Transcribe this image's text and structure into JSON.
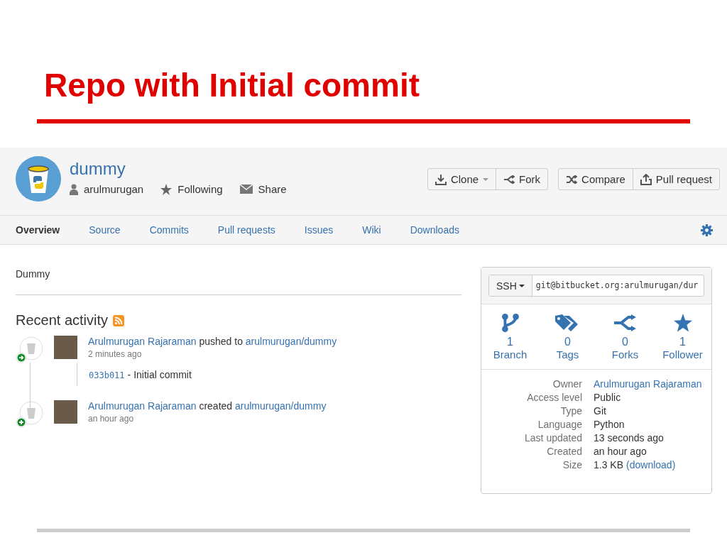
{
  "slide": {
    "title": "Repo with Initial commit"
  },
  "repo": {
    "name": "dummy",
    "owner": "arulmurugan",
    "follow": "Following",
    "share": "Share"
  },
  "action_groups": [
    [
      {
        "label": "Clone",
        "kind": "clone"
      },
      {
        "label": "Fork",
        "kind": "fork"
      }
    ],
    [
      {
        "label": "Compare",
        "kind": "compare"
      },
      {
        "label": "Pull request",
        "kind": "pull"
      }
    ]
  ],
  "tabs": [
    {
      "label": "Overview",
      "selected": true
    },
    {
      "label": "Source",
      "selected": false
    },
    {
      "label": "Commits",
      "selected": false
    },
    {
      "label": "Pull requests",
      "selected": false
    },
    {
      "label": "Issues",
      "selected": false
    },
    {
      "label": "Wiki",
      "selected": false
    },
    {
      "label": "Downloads",
      "selected": false
    }
  ],
  "description": "Dummy",
  "activity": {
    "title": "Recent activity",
    "items": [
      {
        "kind": "push",
        "actor": "Arulmurugan Rajaraman",
        "verb": "pushed to",
        "repo": "arulmurugan/dummy",
        "time": "2 minutes ago",
        "commits": [
          {
            "hash": "033b011",
            "message": "- Initial commit"
          }
        ]
      },
      {
        "kind": "create",
        "actor": "Arulmurugan Rajaraman",
        "verb": "created",
        "repo": "arulmurugan/dummy",
        "time": "an hour ago"
      }
    ]
  },
  "clone": {
    "protocol": "SSH",
    "url": "git@bitbucket.org:arulmurugan/dur"
  },
  "stats": [
    {
      "kind": "branch",
      "count": "1",
      "label": "Branch"
    },
    {
      "kind": "tags",
      "count": "0",
      "label": "Tags"
    },
    {
      "kind": "forks",
      "count": "0",
      "label": "Forks"
    },
    {
      "kind": "followers",
      "count": "1",
      "label": "Follower"
    }
  ],
  "details": [
    {
      "label": "Owner",
      "value": "Arulmurugan Rajaraman",
      "kind": "link"
    },
    {
      "label": "Access level",
      "value": "Public",
      "kind": "text"
    },
    {
      "label": "Type",
      "value": "Git",
      "kind": "text"
    },
    {
      "label": "Language",
      "value": "Python",
      "kind": "text"
    },
    {
      "label": "Last updated",
      "value": "13 seconds ago",
      "kind": "text"
    },
    {
      "label": "Created",
      "value": "an hour ago",
      "kind": "text"
    },
    {
      "label": "Size",
      "value": "1.3 KB",
      "kind": "text",
      "link": "(download)"
    }
  ]
}
